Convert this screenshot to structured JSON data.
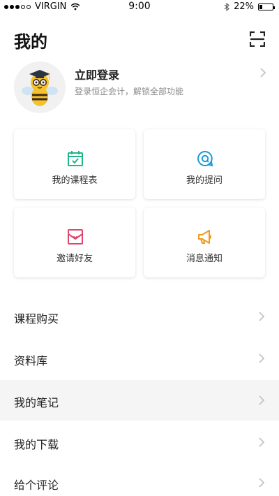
{
  "status_bar": {
    "carrier": "VIRGIN",
    "time": "9:00",
    "battery": "22%",
    "battery_level": 0.22
  },
  "header": {
    "title": "我的",
    "scan_icon": "scan-icon"
  },
  "profile": {
    "avatar_icon": "bee-mascot-avatar",
    "title": "立即登录",
    "subtitle": "登录恒企会计，解锁全部功能"
  },
  "quick_actions": [
    {
      "label": "我的课程表",
      "icon": "calendar-check-icon",
      "color": "#1fb68a"
    },
    {
      "label": "我的提问",
      "icon": "question-bubble-icon",
      "color": "#1a9ad6"
    },
    {
      "label": "邀请好友",
      "icon": "invite-card-icon",
      "color": "#e0466e"
    },
    {
      "label": "消息通知",
      "icon": "megaphone-icon",
      "color": "#f09a1a"
    }
  ],
  "menu": [
    {
      "label": "课程购买"
    },
    {
      "label": "资料库"
    },
    {
      "label": "我的笔记"
    },
    {
      "label": "我的下载"
    },
    {
      "label": "给个评论"
    }
  ],
  "colors": {
    "chevron": "#c4c4c4",
    "active_row": "#f5f5f5"
  }
}
